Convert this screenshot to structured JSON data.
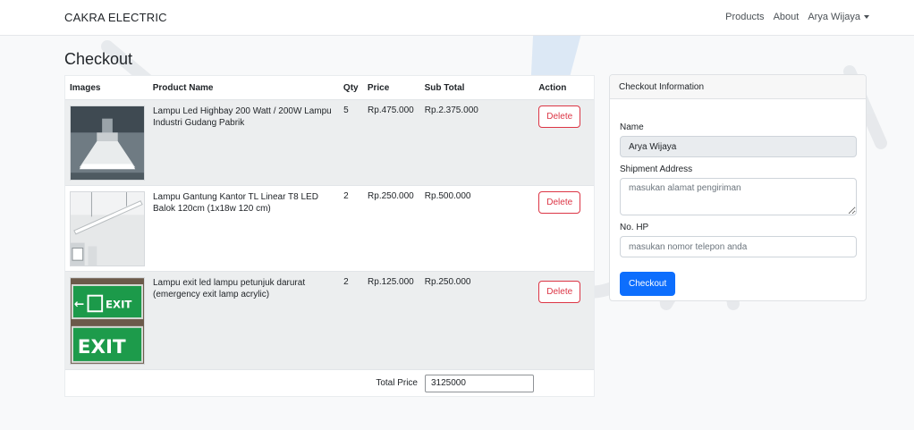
{
  "navbar": {
    "brand": "CAKRA ELECTRIC",
    "links": [
      "Products",
      "About",
      "Arya Wijaya"
    ]
  },
  "page_title": "Checkout",
  "cart": {
    "headers": {
      "images": "Images",
      "product_name": "Product Name",
      "qty": "Qty",
      "price": "Price",
      "subtotal": "Sub Total",
      "action": "Action"
    },
    "items": [
      {
        "name": "Lampu Led Highbay 200 Watt / 200W Lampu Industri Gudang Pabrik",
        "qty": "5",
        "price": "Rp.475.000",
        "subtotal": "Rp.2.375.000",
        "action": "Delete",
        "image_icon": "highbay-lamp-image"
      },
      {
        "name": "Lampu Gantung Kantor TL Linear T8 LED Balok 120cm (1x18w 120 cm)",
        "qty": "2",
        "price": "Rp.250.000",
        "subtotal": "Rp.500.000",
        "action": "Delete",
        "image_icon": "linear-pendant-lamp-image"
      },
      {
        "name": "Lampu exit led lampu petunjuk darurat (emergency exit lamp acrylic)",
        "qty": "2",
        "price": "Rp.125.000",
        "subtotal": "Rp.250.000",
        "action": "Delete",
        "image_icon": "exit-sign-image",
        "image_text": [
          "EXIT",
          "EXIT"
        ]
      }
    ],
    "total_label": "Total Price",
    "total_value": "3125000"
  },
  "checkout": {
    "header": "Checkout Information",
    "name_label": "Name",
    "name_value": "Arya Wijaya",
    "address_label": "Shipment Address",
    "address_placeholder": "masukan alamat pengiriman",
    "phone_label": "No. HP",
    "phone_placeholder": "masukan nomor telepon anda",
    "button": "Checkout"
  },
  "colors": {
    "primary": "#0d6efd",
    "danger": "#dc3545",
    "row_stripe": "#eceeef"
  }
}
